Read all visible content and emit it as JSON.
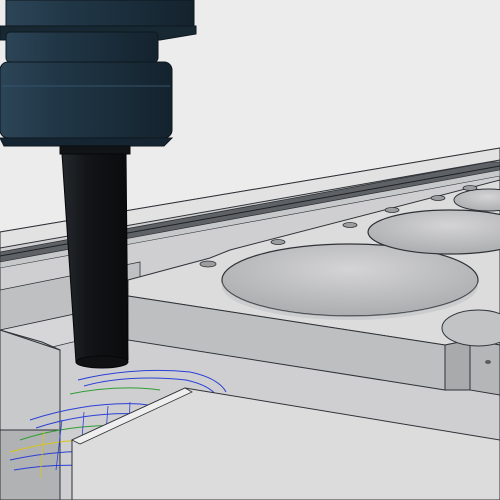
{
  "viewport": {
    "background": "#ececec",
    "icon": "cad-3d-viewport"
  },
  "colors": {
    "part_light": "#d9d9da",
    "part_mid": "#c3c3c5",
    "part_dark": "#a7a8aa",
    "edge": "#2f3236",
    "spindle": "#1f3341",
    "tool": "#15181b",
    "toolpath_blue": "#2a3fd6",
    "toolpath_green": "#2f9e34",
    "toolpath_yellow": "#d7c51c"
  },
  "scene": {
    "model": "fixture-plate-with-bores",
    "tool": "end-mill-in-spindle",
    "toolpath": "contour-passes"
  }
}
